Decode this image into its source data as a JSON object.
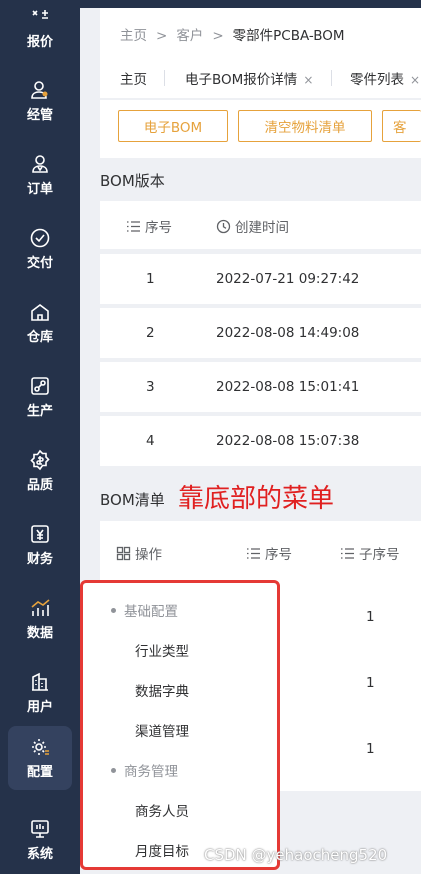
{
  "sidebar": {
    "items": [
      {
        "label": "报价",
        "icon": "quote-icon"
      },
      {
        "label": "经管",
        "icon": "user-manage-icon"
      },
      {
        "label": "订单",
        "icon": "order-icon"
      },
      {
        "label": "交付",
        "icon": "check-circle-icon"
      },
      {
        "label": "仓库",
        "icon": "warehouse-icon"
      },
      {
        "label": "生产",
        "icon": "production-icon"
      },
      {
        "label": "品质",
        "icon": "quality-icon"
      },
      {
        "label": "财务",
        "icon": "finance-icon"
      },
      {
        "label": "数据",
        "icon": "data-chart-icon"
      },
      {
        "label": "用户",
        "icon": "user-building-icon"
      },
      {
        "label": "配置",
        "icon": "config-gear-icon",
        "active": true
      },
      {
        "label": "系统",
        "icon": "system-monitor-icon"
      }
    ]
  },
  "breadcrumb": {
    "items": [
      "主页",
      "客户",
      "零部件PCBA-BOM"
    ],
    "separator": ">"
  },
  "tabs": [
    {
      "label": "主页",
      "closable": false
    },
    {
      "label": "电子BOM报价详情",
      "closable": true
    },
    {
      "label": "零件列表",
      "closable": true
    }
  ],
  "tab_close_glyph": "×",
  "buttons": [
    "电子BOM",
    "清空物料清单",
    "客"
  ],
  "bom_version": {
    "title": "BOM版本",
    "columns": [
      "序号",
      "创建时间"
    ],
    "rows": [
      {
        "no": "1",
        "time": "2022-07-21 09:27:42"
      },
      {
        "no": "2",
        "time": "2022-08-08 14:49:08"
      },
      {
        "no": "3",
        "time": "2022-08-08 15:01:41"
      },
      {
        "no": "4",
        "time": "2022-08-08 15:07:38"
      }
    ]
  },
  "bom_list": {
    "title": "BOM清单",
    "columns": [
      "操作",
      "序号",
      "子序号"
    ],
    "values": [
      "1",
      "1",
      "1"
    ]
  },
  "annotation": "靠底部的菜单",
  "popup_menu": {
    "groups": [
      {
        "title": "基础配置",
        "items": [
          "行业类型",
          "数据字典",
          "渠道管理"
        ]
      },
      {
        "title": "商务管理",
        "items": [
          "商务人员",
          "月度目标"
        ]
      }
    ]
  },
  "watermark": "CSDN @yehaocheng520",
  "colors": {
    "sidebar": "#25324a",
    "accent": "#e6a23c",
    "annotation": "#e02020",
    "menu_border": "#e53935"
  }
}
